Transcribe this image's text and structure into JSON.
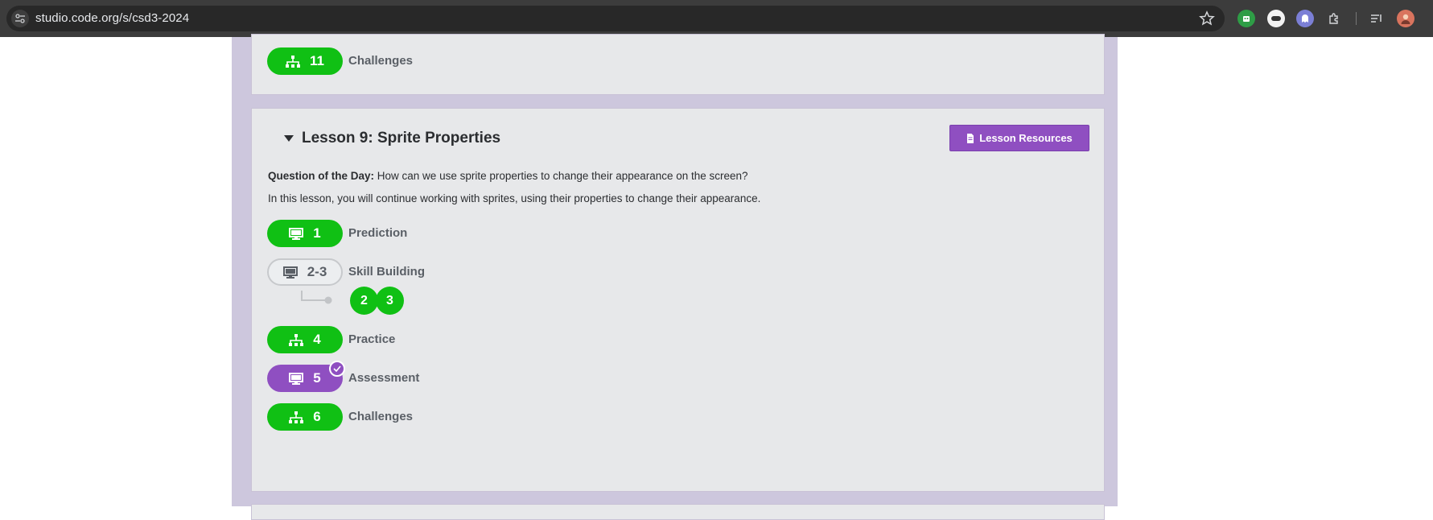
{
  "browser": {
    "url": "studio.code.org/s/csd3-2024"
  },
  "top_card": {
    "level_number": "11",
    "level_label": "Challenges"
  },
  "lesson": {
    "title": "Lesson 9: Sprite Properties",
    "resources_button": "Lesson Resources",
    "question_label": "Question of the Day:",
    "question_text": "How can we use sprite properties to change their appearance on the screen?",
    "description": "In this lesson, you will continue working with sprites, using their properties to change their appearance.",
    "levels": [
      {
        "number": "1",
        "label": "Prediction",
        "icon": "monitor-icon",
        "style": "green"
      },
      {
        "number": "2-3",
        "label": "Skill Building",
        "icon": "monitor-icon",
        "style": "outline"
      },
      {
        "number": "4",
        "label": "Practice",
        "icon": "hierarchy-icon",
        "style": "green"
      },
      {
        "number": "5",
        "label": "Assessment",
        "icon": "monitor-icon",
        "style": "purple"
      },
      {
        "number": "6",
        "label": "Challenges",
        "icon": "hierarchy-icon",
        "style": "green"
      }
    ],
    "sublevels": [
      "2",
      "3"
    ]
  },
  "colors": {
    "green": "#10c014",
    "purple": "#8f4fc1",
    "page_bg": "#cdc7dd",
    "card_bg": "#e7e8ea"
  }
}
